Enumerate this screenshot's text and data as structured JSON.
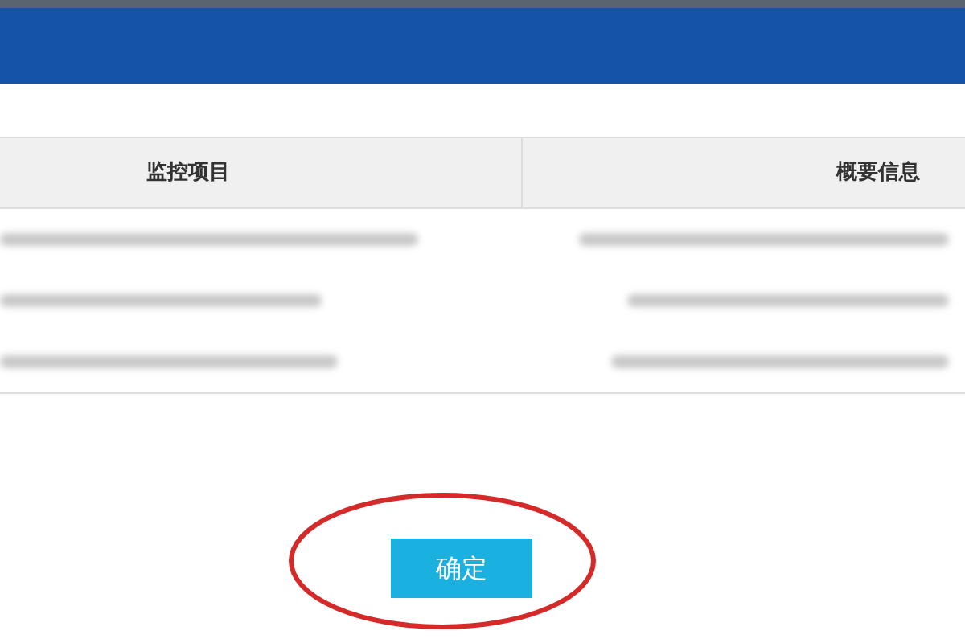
{
  "table": {
    "columns": [
      "监控项目",
      "概要信息"
    ]
  },
  "button": {
    "label": "确定"
  }
}
